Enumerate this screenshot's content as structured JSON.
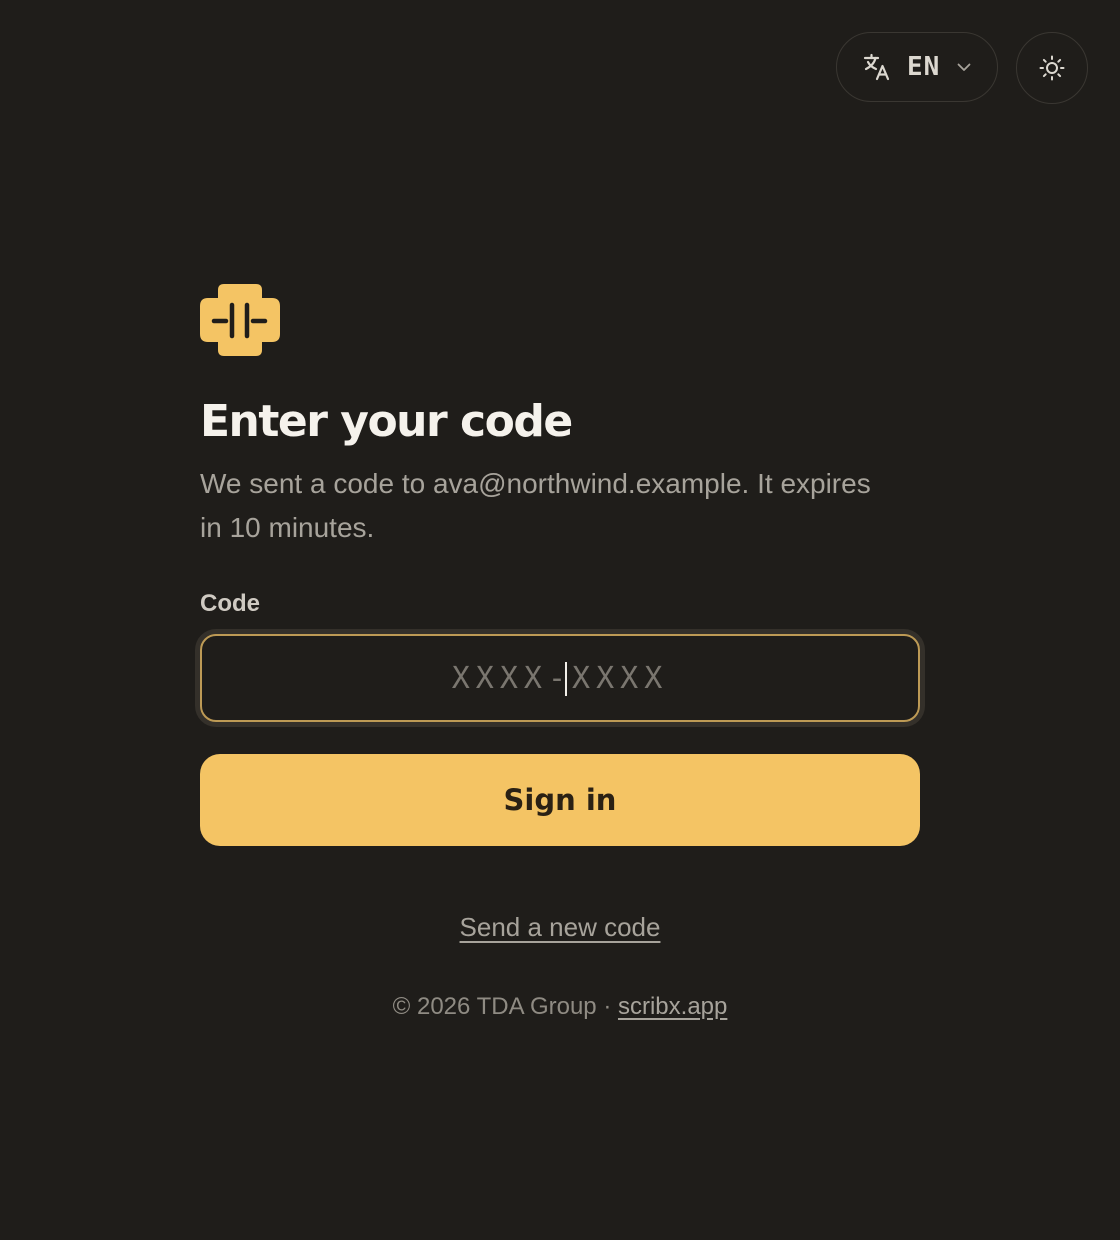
{
  "header": {
    "language_code": "EN",
    "icons": {
      "language": "translate-icon",
      "dropdown": "chevron-down-icon",
      "theme": "sun-icon"
    }
  },
  "brand": {
    "logo_icon": "scribx-logo-icon",
    "accent_color": "#f4c464"
  },
  "login": {
    "title": "Enter your code",
    "subtitle": "We sent a code to ava@northwind.example. It expires in 10 minutes.",
    "code_label": "Code",
    "code_value": "",
    "code_placeholder": "XXXX-XXXX",
    "submit_label": "Sign in",
    "resend_label": "Send a new code"
  },
  "footer": {
    "copyright": "© 2026 TDA Group · ",
    "site_link": "scribx.app"
  }
}
